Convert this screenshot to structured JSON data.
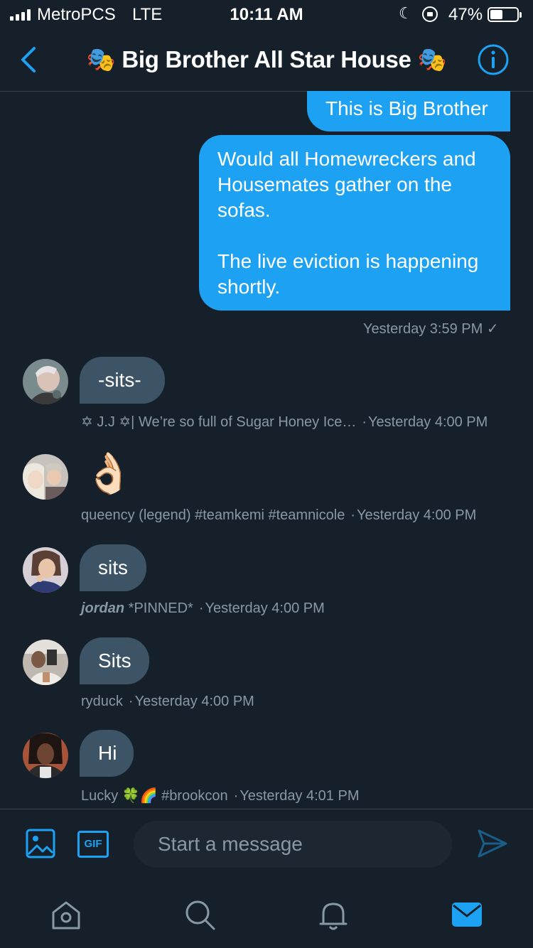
{
  "status_bar": {
    "carrier": "MetroPCS",
    "network": "LTE",
    "time": "10:11 AM",
    "battery_percent": "47%",
    "battery_level": 0.47,
    "icons": [
      "signal-bars-icon",
      "moon-icon",
      "rotation-lock-icon",
      "battery-icon"
    ]
  },
  "header": {
    "title": "🎭 Big Brother All Star House 🎭",
    "back_icon": "chevron-left-icon",
    "info_icon": "info-icon"
  },
  "messages": {
    "sent_1": {
      "text": "This is Big Brother"
    },
    "sent_2": {
      "paragraph_1": "Would all Homewreckers and Housemates gather on the sofas.",
      "paragraph_2": "The live eviction is happening shortly.",
      "timestamp": "Yesterday 3:59 PM",
      "read_mark": "✓"
    },
    "recv_1": {
      "text": "-sits-",
      "sender": "✡ J.J ✡| We’re so full of Sugar Honey Ice…",
      "timestamp": "Yesterday 4:00 PM"
    },
    "recv_2": {
      "text": "👌🏻",
      "sender": "queency (legend) #teamkemi #teamnicole",
      "timestamp": "Yesterday 4:00 PM"
    },
    "recv_3": {
      "text": "sits",
      "sender_bold": "jordan",
      "sender_rest": " *PINNED*",
      "timestamp": "Yesterday 4:00 PM"
    },
    "recv_4": {
      "text": "Sits",
      "sender": "ryduck",
      "timestamp": "Yesterday 4:00 PM"
    },
    "recv_5": {
      "text": "Hi",
      "sender": "Lucky 🍀🌈 #brookcon",
      "timestamp": "Yesterday 4:01 PM"
    },
    "separator": "·"
  },
  "compose": {
    "placeholder": "Start a message",
    "gif_label": "GIF",
    "icons": [
      "image-icon",
      "gif-icon",
      "send-icon"
    ]
  },
  "tabs": [
    "home-icon",
    "search-icon",
    "notifications-icon",
    "messages-icon"
  ],
  "colors": {
    "background": "#15202b",
    "accent": "#1da1f2",
    "incoming_bubble": "#3d5466",
    "secondary_text": "#8899a6",
    "divider": "#38444d"
  }
}
